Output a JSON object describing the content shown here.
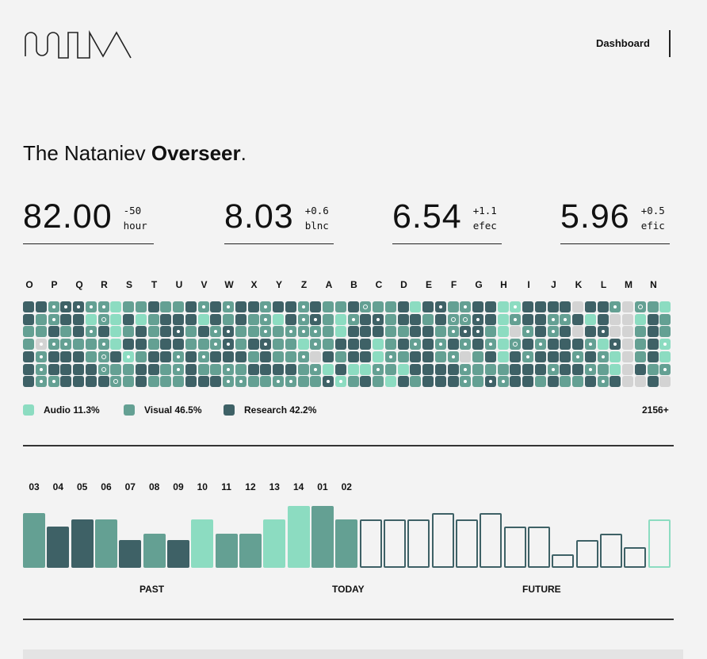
{
  "header": {
    "logo": "NTNV",
    "nav_link": "Dashboard"
  },
  "title": {
    "prefix": "The Nataniev ",
    "bold": "Overseer",
    "suffix": "."
  },
  "stats": [
    {
      "value": "82.00",
      "delta": "-50",
      "unit": "hour"
    },
    {
      "value": "8.03",
      "delta": "+0.6",
      "unit": "blnc"
    },
    {
      "value": "6.54",
      "delta": "+1.1",
      "unit": "efec"
    },
    {
      "value": "5.96",
      "delta": "+0.5",
      "unit": "efic"
    }
  ],
  "colors": {
    "dark": "#3e6166",
    "mid": "#64a093",
    "light": "#8cdcc1",
    "gray": "#d3d3d3",
    "bg": "#f3f3f3"
  },
  "grid": {
    "columns": [
      "O",
      "P",
      "Q",
      "R",
      "S",
      "T",
      "U",
      "V",
      "W",
      "X",
      "Y",
      "Z",
      "A",
      "B",
      "C",
      "D",
      "E",
      "F",
      "G",
      "H",
      "I",
      "J",
      "K",
      "L",
      "M",
      "N"
    ],
    "rows": [
      "ddMDDMMlmmdmmdMdMddMddMdmmdRmmdldDmMddlLddddgddMgRml",
      "dmMddlRldlmdddldmdmMldMDmlMdDmddmdRRDdlMddMMdldggldm",
      "mmdmdMdlmdmdDmdMDmmMmMMMmldddmmddmMDDmlgMdMdgdDggmdm",
      "mGMMmmMlddmddmmMDmdDmmlMmdddlmdMdMdMdMlRdMdddMlDgmdL",
      "dMdddmRdLmddMdMdddmdmmMgdmddlMmddmMgmdldMdddMdMlgmdl",
      "dMddddRmmddmMdmmMmddddmMldllMmlddddMmmmdddMddMmlgdmM",
      "dMMddddRmdmmmdddMMmmMMmmDLmdmldmdddMmDMddmdmmdMdggdg"
    ]
  },
  "legend": [
    {
      "label": "Audio 11.3%",
      "color": "light"
    },
    {
      "label": "Visual 46.5%",
      "color": "mid"
    },
    {
      "label": "Research 42.2%",
      "color": "dark"
    }
  ],
  "total": "2156+",
  "chart_data": {
    "type": "bar",
    "categories": [
      "03",
      "04",
      "05",
      "06",
      "07",
      "08",
      "09",
      "10",
      "11",
      "12",
      "13",
      "14",
      "01",
      "02"
    ],
    "past_values": [
      8,
      6,
      7,
      7,
      4,
      5,
      4,
      7,
      5,
      5,
      7,
      9,
      9,
      7
    ],
    "past_colors": [
      "mid",
      "dark",
      "dark",
      "mid",
      "dark",
      "mid",
      "dark",
      "light",
      "mid",
      "mid",
      "light",
      "light",
      "mid",
      "mid"
    ],
    "future_values": [
      7,
      7,
      7,
      8,
      7,
      8,
      6,
      6,
      2,
      4,
      5,
      3,
      7
    ],
    "future_outline": [
      "dark",
      "dark",
      "dark",
      "dark",
      "dark",
      "dark",
      "dark",
      "dark",
      "dark",
      "dark",
      "dark",
      "dark",
      "light"
    ],
    "period_labels": [
      "PAST",
      "TODAY",
      "FUTURE"
    ],
    "ylim": [
      0,
      9
    ]
  }
}
